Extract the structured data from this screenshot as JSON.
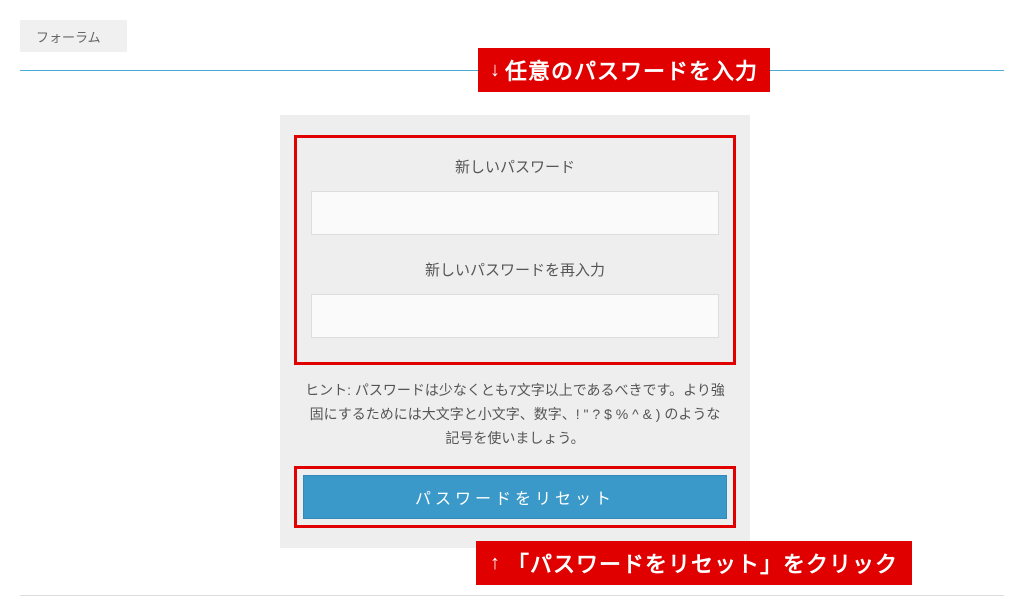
{
  "breadcrumb": {
    "label": "フォーラム"
  },
  "annotations": {
    "top": "任意のパスワードを入力",
    "bottom": "「パスワードをリセット」をクリック"
  },
  "form": {
    "new_password_label": "新しいパスワード",
    "confirm_password_label": "新しいパスワードを再入力",
    "hint": "ヒント: パスワードは少なくとも7文字以上であるべきです。より強固にするためには大文字と小文字、数字、! \" ? $ % ^ & ) のような記号を使いましょう。",
    "reset_button_label": "パスワードをリセット"
  }
}
